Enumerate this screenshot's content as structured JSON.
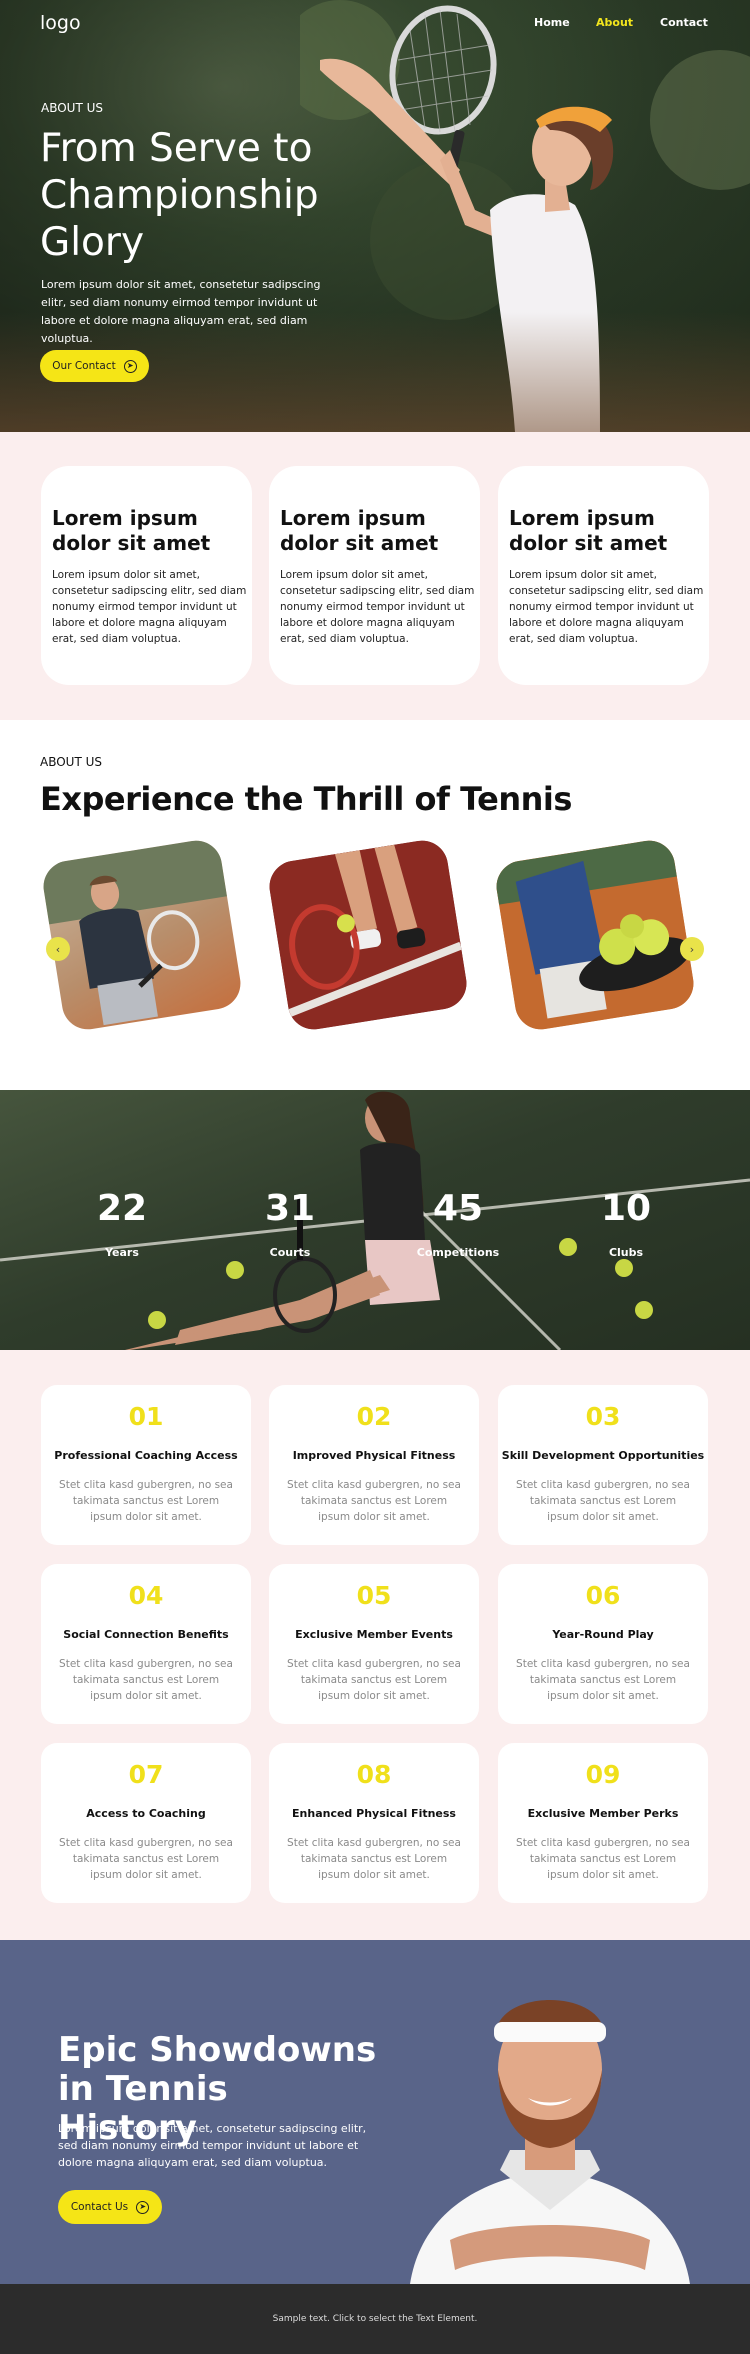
{
  "header": {
    "logo": "logo",
    "nav": [
      {
        "label": "Home",
        "active": false
      },
      {
        "label": "About",
        "active": true
      },
      {
        "label": "Contact",
        "active": false
      }
    ]
  },
  "hero": {
    "eyebrow": "ABOUT US",
    "title": "From Serve to Championship Glory",
    "text": "Lorem ipsum dolor sit amet, consetetur sadipscing elitr, sed diam nonumy eirmod tempor invidunt ut labore et dolore magna aliquyam erat, sed diam voluptua.",
    "button": "Our Contact",
    "button_icon": "arrow-right-circle-icon"
  },
  "features": [
    {
      "title": "Lorem ipsum dolor sit amet",
      "text": "Lorem ipsum dolor sit amet, consetetur sadipscing elitr, sed diam nonumy eirmod tempor invidunt ut labore et dolore magna aliquyam erat, sed diam voluptua."
    },
    {
      "title": "Lorem ipsum dolor sit amet",
      "text": "Lorem ipsum dolor sit amet, consetetur sadipscing elitr, sed diam nonumy eirmod tempor invidunt ut labore et dolore magna aliquyam erat, sed diam voluptua."
    },
    {
      "title": "Lorem ipsum dolor sit amet",
      "text": "Lorem ipsum dolor sit amet, consetetur sadipscing elitr, sed diam nonumy eirmod tempor invidunt ut labore et dolore magna aliquyam erat, sed diam voluptua."
    }
  ],
  "about": {
    "eyebrow": "ABOUT US",
    "title": "Experience the Thrill of Tennis",
    "prev_icon": "chevron-left-icon",
    "next_icon": "chevron-right-icon"
  },
  "stats": [
    {
      "value": "22",
      "label": "Years"
    },
    {
      "value": "31",
      "label": "Courts"
    },
    {
      "value": "45",
      "label": "Competitions"
    },
    {
      "value": "10",
      "label": "Clubs"
    }
  ],
  "benefits": [
    {
      "num": "01",
      "title": "Professional Coaching Access",
      "text": "Stet clita kasd gubergren, no sea takimata sanctus est Lorem ipsum dolor sit amet."
    },
    {
      "num": "02",
      "title": "Improved Physical Fitness",
      "text": "Stet clita kasd gubergren, no sea takimata sanctus est Lorem ipsum dolor sit amet."
    },
    {
      "num": "03",
      "title": "Skill Development Opportunities",
      "text": "Stet clita kasd gubergren, no sea takimata sanctus est Lorem ipsum dolor sit amet."
    },
    {
      "num": "04",
      "title": "Social Connection Benefits",
      "text": "Stet clita kasd gubergren, no sea takimata sanctus est Lorem ipsum dolor sit amet."
    },
    {
      "num": "05",
      "title": "Exclusive Member Events",
      "text": "Stet clita kasd gubergren, no sea takimata sanctus est Lorem ipsum dolor sit amet."
    },
    {
      "num": "06",
      "title": "Year-Round Play",
      "text": "Stet clita kasd gubergren, no sea takimata sanctus est Lorem ipsum dolor sit amet."
    },
    {
      "num": "07",
      "title": "Access to Coaching",
      "text": "Stet clita kasd gubergren, no sea takimata sanctus est Lorem ipsum dolor sit amet."
    },
    {
      "num": "08",
      "title": "Enhanced Physical Fitness",
      "text": "Stet clita kasd gubergren, no sea takimata sanctus est Lorem ipsum dolor sit amet."
    },
    {
      "num": "09",
      "title": "Exclusive Member Perks",
      "text": "Stet clita kasd gubergren, no sea takimata sanctus est Lorem ipsum dolor sit amet."
    }
  ],
  "epic": {
    "title": "Epic Showdowns in Tennis History",
    "text": "Lorem ipsum dolor sit amet, consetetur sadipscing elitr, sed diam nonumy eirmod tempor invidunt ut labore et dolore magna aliquyam erat, sed diam voluptua.",
    "button": "Contact Us",
    "button_icon": "arrow-right-circle-icon"
  },
  "footer": {
    "text": "Sample text. Click to select the Text Element."
  },
  "colors": {
    "accent": "#f5e516",
    "pink_bg": "#fbeeee",
    "epic_bg": "#596489",
    "footer_bg": "#2c2c2c"
  }
}
